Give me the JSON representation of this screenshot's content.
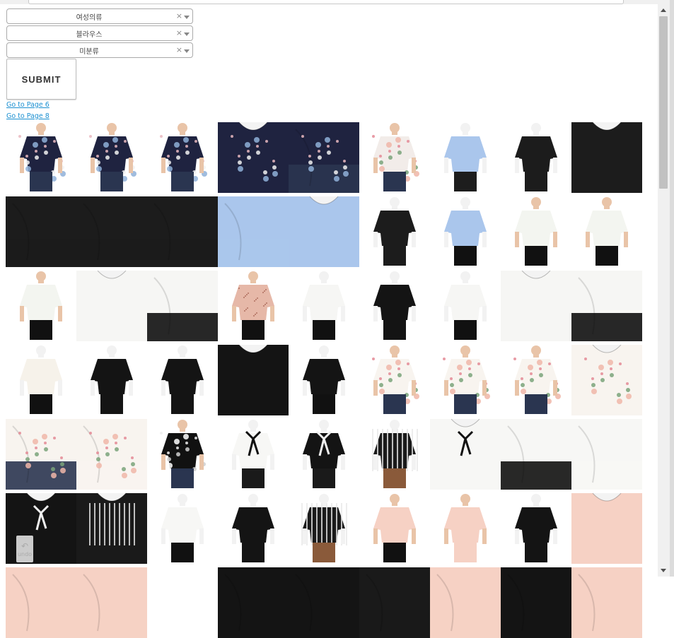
{
  "filters": [
    {
      "value": "여성의류",
      "clear": "×"
    },
    {
      "value": "블라우스",
      "clear": "×"
    },
    {
      "value": "미분류",
      "clear": "×"
    }
  ],
  "submit_label": "SUBMIT",
  "links": {
    "prev": "Go to Page 6",
    "next": "Go to Page 8"
  },
  "undo": {
    "glyph": "↶",
    "label": "undo"
  },
  "products": [
    {
      "top": "#1f2340",
      "bottom": "#2a3550",
      "pattern": "floral",
      "view": "front"
    },
    {
      "top": "#1f2340",
      "bottom": "#2a3550",
      "pattern": "floral",
      "view": "side"
    },
    {
      "top": "#1f2340",
      "bottom": "#2a3550",
      "pattern": "floral",
      "view": "back"
    },
    {
      "top": "#1f2340",
      "bottom": "#2a3550",
      "pattern": "floral",
      "view": "closeup"
    },
    {
      "top": "#1f2340",
      "bottom": "#2a3550",
      "pattern": "floral",
      "view": "fabric"
    },
    {
      "top": "#f2ece9",
      "bottom": "#2a3550",
      "pattern": "floral-light",
      "view": "front"
    },
    {
      "top": "#aac6ec",
      "bottom": "#1d1d1d",
      "pattern": "solid",
      "view": "mannequin"
    },
    {
      "top": "#1c1c1c",
      "bottom": "#1c1c1c",
      "pattern": "solid",
      "view": "mannequin"
    },
    {
      "top": "#1c1c1c",
      "bottom": "#1c1c1c",
      "pattern": "solid",
      "view": "closeup"
    },
    {
      "top": "#1c1c1c",
      "bottom": "#1c1c1c",
      "pattern": "solid",
      "view": "fabric"
    },
    {
      "top": "#1c1c1c",
      "bottom": "#1c1c1c",
      "pattern": "solid",
      "view": "fabric"
    },
    {
      "top": "#1c1c1c",
      "bottom": "#1c1c1c",
      "pattern": "solid",
      "view": "fabric"
    },
    {
      "top": "#aac6ec",
      "bottom": "#aac6ec",
      "pattern": "solid",
      "view": "fabric"
    },
    {
      "top": "#aac6ec",
      "bottom": "#aac6ec",
      "pattern": "solid",
      "view": "closeup"
    },
    {
      "top": "#1c1c1c",
      "bottom": "#1c1c1c",
      "pattern": "solid",
      "view": "mannequin"
    },
    {
      "top": "#aac6ec",
      "bottom": "#111111",
      "pattern": "solid",
      "view": "mannequin"
    },
    {
      "top": "#f3f5f0",
      "bottom": "#111111",
      "pattern": "solid",
      "view": "front"
    },
    {
      "top": "#f3f5f0",
      "bottom": "#111111",
      "pattern": "solid",
      "view": "front"
    },
    {
      "top": "#f3f5f0",
      "bottom": "#111111",
      "pattern": "solid",
      "view": "front"
    },
    {
      "top": "#f6f6f4",
      "bottom": "#f6f6f4",
      "pattern": "solid",
      "view": "closeup"
    },
    {
      "top": "#f6f6f4",
      "bottom": "#111111",
      "pattern": "solid",
      "view": "fabric"
    },
    {
      "top": "#e6b8a8",
      "bottom": "#111111",
      "pattern": "dots",
      "view": "front"
    },
    {
      "top": "#f6f6f4",
      "bottom": "#111111",
      "pattern": "solid",
      "view": "mannequin"
    },
    {
      "top": "#141414",
      "bottom": "#141414",
      "pattern": "solid",
      "view": "mannequin"
    },
    {
      "top": "#f6f6f4",
      "bottom": "#111111",
      "pattern": "solid",
      "view": "mannequin"
    },
    {
      "top": "#f6f6f4",
      "bottom": "#f6f6f4",
      "pattern": "solid",
      "view": "closeup"
    },
    {
      "top": "#f6f6f4",
      "bottom": "#111111",
      "pattern": "solid",
      "view": "fabric"
    },
    {
      "top": "#f6f2ea",
      "bottom": "#111111",
      "pattern": "solid",
      "view": "mannequin"
    },
    {
      "top": "#141414",
      "bottom": "#141414",
      "pattern": "solid",
      "view": "mannequin"
    },
    {
      "top": "#141414",
      "bottom": "#141414",
      "pattern": "solid",
      "view": "mannequin"
    },
    {
      "top": "#141414",
      "bottom": "#141414",
      "pattern": "solid",
      "view": "closeup"
    },
    {
      "top": "#141414",
      "bottom": "#111111",
      "pattern": "solid",
      "view": "mannequin"
    },
    {
      "top": "#f8f4ef",
      "bottom": "#2a3550",
      "pattern": "floral-light",
      "view": "front"
    },
    {
      "top": "#f8f4ef",
      "bottom": "#2a3550",
      "pattern": "floral-light",
      "view": "front"
    },
    {
      "top": "#f8f4ef",
      "bottom": "#2a3550",
      "pattern": "floral-light",
      "view": "front"
    },
    {
      "top": "#f8f4ef",
      "bottom": "#f8f4ef",
      "pattern": "floral-light",
      "view": "closeup"
    },
    {
      "top": "#f8f4ef",
      "bottom": "#2a3550",
      "pattern": "floral-light",
      "view": "fabric"
    },
    {
      "top": "#f8f4ef",
      "bottom": "#f8f4ef",
      "pattern": "floral-light",
      "view": "fabric"
    },
    {
      "top": "#111111",
      "bottom": "#2a3550",
      "pattern": "floral-dark",
      "view": "front"
    },
    {
      "top": "#f7f7f5",
      "bottom": "#1a1a1a",
      "pattern": "bow",
      "view": "mannequin"
    },
    {
      "top": "#141414",
      "bottom": "#1a1a1a",
      "pattern": "bow-light",
      "view": "mannequin"
    },
    {
      "top": "#1a1a1a",
      "bottom": "#8a5a3a",
      "pattern": "stripes",
      "view": "mannequin"
    },
    {
      "top": "#f7f7f5",
      "bottom": "#f7f7f5",
      "pattern": "bow",
      "view": "closeup"
    },
    {
      "top": "#f7f7f5",
      "bottom": "#111111",
      "pattern": "solid",
      "view": "fabric"
    },
    {
      "top": "#f7f7f5",
      "bottom": "#f7f7f5",
      "pattern": "solid",
      "view": "fabric"
    },
    {
      "top": "#141414",
      "bottom": "#141414",
      "pattern": "bow-light",
      "view": "closeup"
    },
    {
      "top": "#1a1a1a",
      "bottom": "#1a1a1a",
      "pattern": "stripes",
      "view": "closeup"
    },
    {
      "top": "#f7f7f5",
      "bottom": "#111111",
      "pattern": "solid",
      "view": "mannequin"
    },
    {
      "top": "#141414",
      "bottom": "#141414",
      "pattern": "solid",
      "view": "mannequin"
    },
    {
      "top": "#1a1a1a",
      "bottom": "#8a5a3a",
      "pattern": "stripes",
      "view": "mannequin"
    },
    {
      "top": "#f6d1c4",
      "bottom": "#111111",
      "pattern": "solid",
      "view": "front"
    },
    {
      "top": "#f6d1c4",
      "bottom": "#f6d1c4",
      "pattern": "solid",
      "view": "front"
    },
    {
      "top": "#141414",
      "bottom": "#141414",
      "pattern": "solid",
      "view": "mannequin"
    },
    {
      "top": "#f6d1c4",
      "bottom": "#f6d1c4",
      "pattern": "solid",
      "view": "closeup"
    },
    {
      "top": "#f6d1c4",
      "bottom": "#f6d1c4",
      "pattern": "solid",
      "view": "fabric"
    },
    {
      "top": "#f6d1c4",
      "bottom": "#f6d1c4",
      "pattern": "solid",
      "view": "fabric"
    },
    {
      "top": "#ffffff",
      "bottom": "#ffffff",
      "pattern": "solid",
      "view": "blank"
    },
    {
      "top": "#141414",
      "bottom": "#141414",
      "pattern": "solid",
      "view": "fabric"
    },
    {
      "top": "#141414",
      "bottom": "#141414",
      "pattern": "solid",
      "view": "fabric"
    },
    {
      "top": "#1a1a1a",
      "bottom": "#1a1a1a",
      "pattern": "solid",
      "view": "fabric"
    },
    {
      "top": "#f6d1c4",
      "bottom": "#f6d1c4",
      "pattern": "solid",
      "view": "fabric"
    },
    {
      "top": "#141414",
      "bottom": "#141414",
      "pattern": "solid",
      "view": "fabric"
    },
    {
      "top": "#f6d1c4",
      "bottom": "#f6d1c4",
      "pattern": "solid",
      "view": "fabric"
    }
  ]
}
